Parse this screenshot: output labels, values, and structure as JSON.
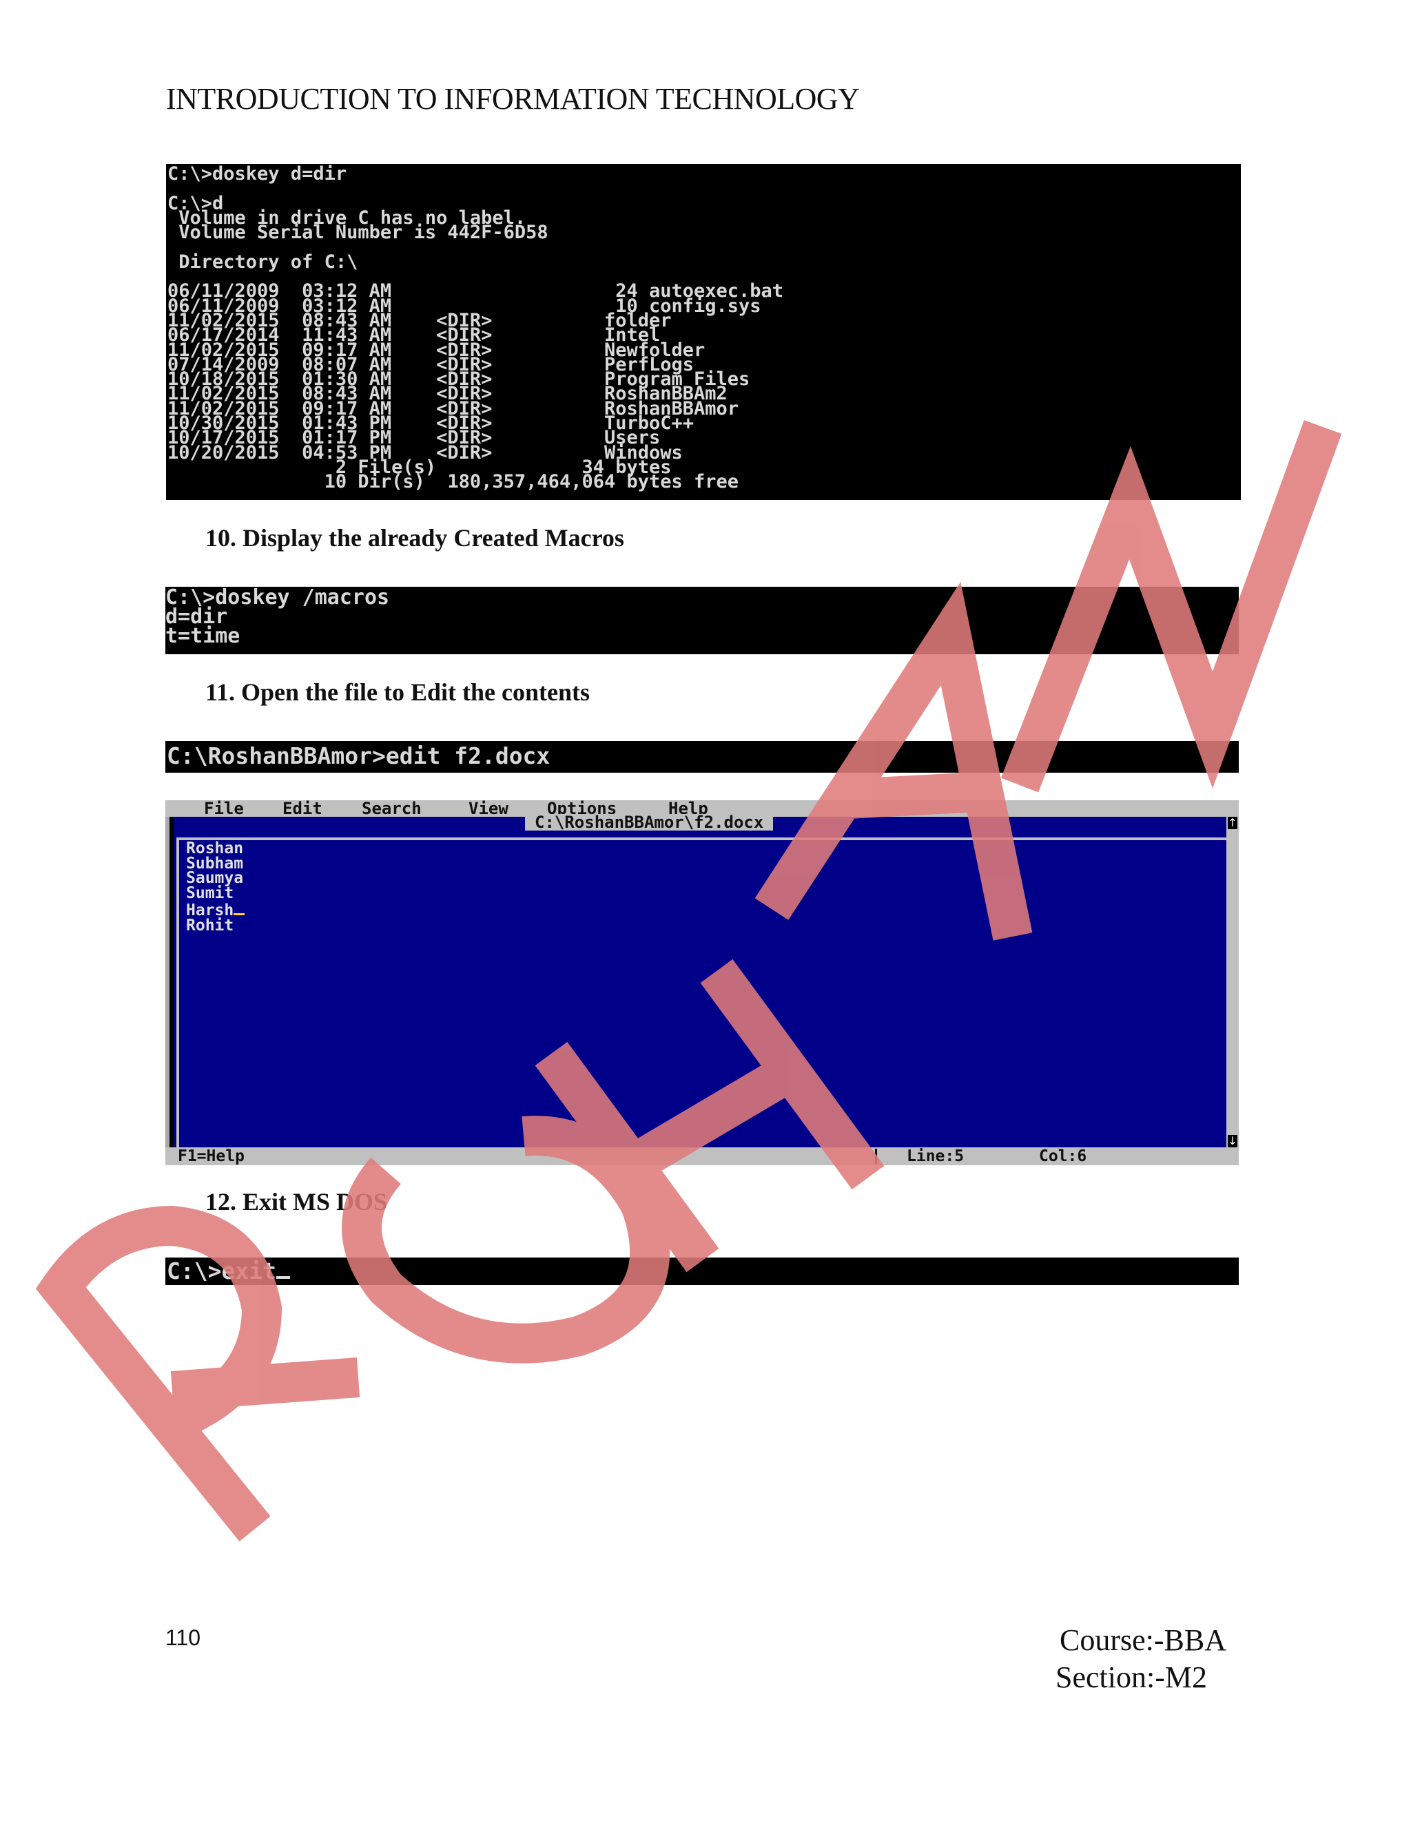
{
  "header": {
    "title": "INTRODUCTION TO INFORMATION TECHNOLOGY"
  },
  "console_dir": {
    "lines": [
      "C:\\>doskey d=dir",
      "",
      "C:\\>d",
      " Volume in drive C has no label.",
      " Volume Serial Number is 442F-6D58",
      "",
      " Directory of C:\\",
      "",
      "06/11/2009  03:12 AM                    24 autoexec.bat",
      "06/11/2009  03:12 AM                    10 config.sys",
      "11/02/2015  08:43 AM    <DIR>          folder",
      "06/17/2014  11:43 AM    <DIR>          Intel",
      "11/02/2015  09:17 AM    <DIR>          Newfolder",
      "07/14/2009  08:07 AM    <DIR>          PerfLogs",
      "10/18/2015  01:30 AM    <DIR>          Program Files",
      "11/02/2015  08:43 AM    <DIR>          RoshanBBAm2",
      "11/02/2015  09:17 AM    <DIR>          RoshanBBAmor",
      "10/30/2015  01:43 PM    <DIR>          TurboC++",
      "10/17/2015  01:17 PM    <DIR>          Users",
      "10/20/2015  04:53 PM    <DIR>          Windows",
      "               2 File(s)             34 bytes",
      "              10 Dir(s)  180,357,464,064 bytes free"
    ]
  },
  "step10": {
    "heading": "10. Display the already Created Macros"
  },
  "console_macros": {
    "lines": [
      "C:\\>doskey /macros",
      "d=dir",
      "t=time"
    ]
  },
  "step11": {
    "heading": "11. Open the file to Edit the contents"
  },
  "console_edit": {
    "command": "C:\\RoshanBBAmor>edit f2.docx"
  },
  "editor": {
    "menu": [
      "File",
      "Edit",
      "Search",
      "View",
      "Options",
      "Help"
    ],
    "file_title": "C:\\RoshanBBAmor\\f2.docx",
    "lines": [
      "Roshan",
      "Subham",
      "Saumya",
      "Sumit",
      "Harsh",
      "Rohit"
    ],
    "status_help": "F1=Help",
    "status_line": "Line:5",
    "status_col": "Col:6",
    "scroll_up": "↑",
    "scroll_down": "↓"
  },
  "step12": {
    "heading": "12. Exit MS DOS"
  },
  "console_exit": {
    "command": "C:\\>exit"
  },
  "footer": {
    "page_number": "110",
    "course": "Course:-BBA",
    "section": "Section:-M2"
  },
  "watermark": {
    "text": "ROHAN",
    "color": "#e07b7b"
  }
}
